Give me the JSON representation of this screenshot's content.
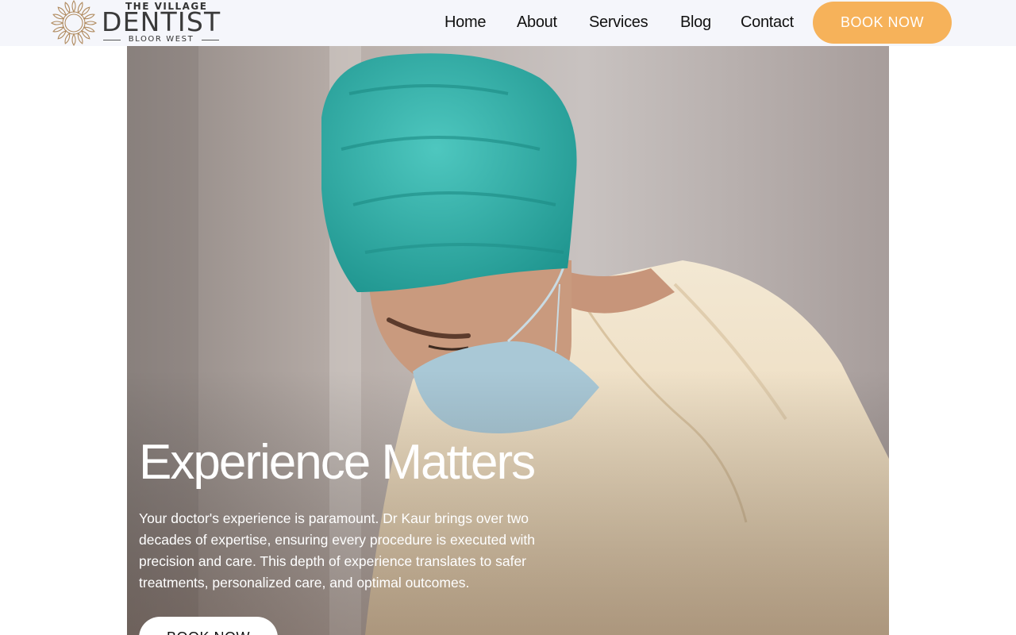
{
  "logo": {
    "top_line": "THE VILLAGE",
    "main": "DENTIST",
    "sub": "BLOOR WEST",
    "icon": "sunburst-logo-icon"
  },
  "nav": {
    "items": [
      {
        "label": "Home"
      },
      {
        "label": "About"
      },
      {
        "label": "Services"
      },
      {
        "label": "Blog"
      },
      {
        "label": "Contact"
      }
    ],
    "cta_label": "BOOK NOW"
  },
  "hero": {
    "title": "Experience Matters",
    "text": "Your doctor's experience is paramount. Dr Kaur brings over two decades of expertise, ensuring every procedure is executed with precision and care. This depth of experience translates to safer treatments, personalized care, and optimal outcomes.",
    "cta_label": "BOOK NOW"
  },
  "colors": {
    "accent": "#f6b25a",
    "header_bg": "#f5f6fb",
    "scrub_cap": "#2fb3ad",
    "gown": "#efe1c8",
    "mask": "#a9c8d6"
  }
}
